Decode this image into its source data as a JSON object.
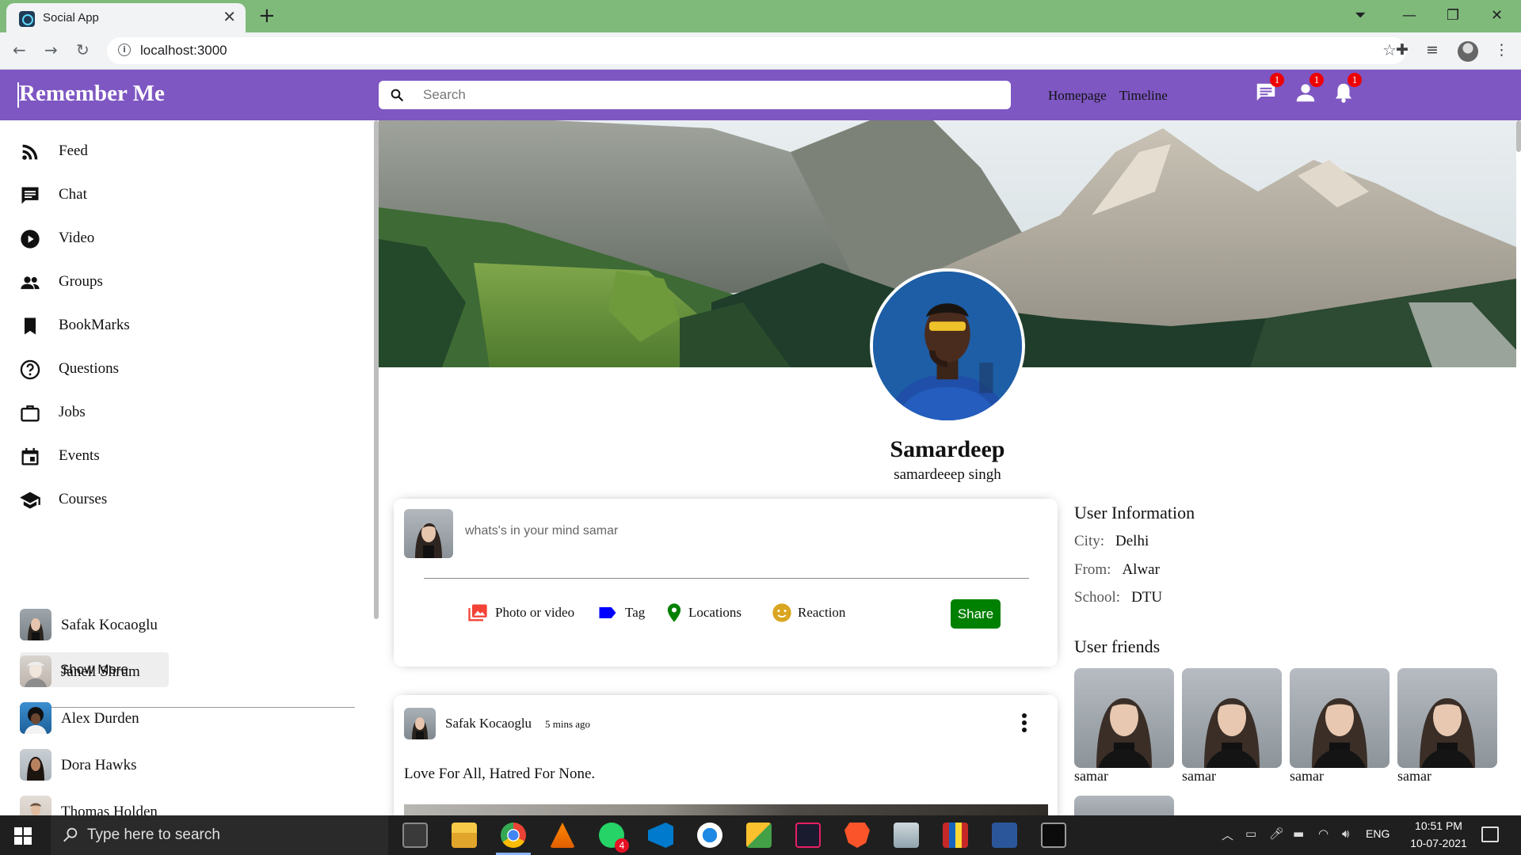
{
  "browser": {
    "tab_title": "Social App",
    "url": "localhost:3000",
    "icons": [
      "back-icon",
      "forward-icon",
      "reload-icon",
      "info-icon",
      "star-icon",
      "extensions-icon",
      "media-icon",
      "profile-icon",
      "menu-icon"
    ]
  },
  "app": {
    "brand": "Remember Me",
    "search_placeholder": "Search",
    "nav_links": [
      "Homepage",
      "Timeline"
    ],
    "badges": {
      "chat": "1",
      "person": "1",
      "notifications": "1"
    },
    "accent_color": "#7e57c2"
  },
  "sidebar": {
    "items": [
      {
        "label": "Feed",
        "icon": "rss-feed-icon"
      },
      {
        "label": "Chat",
        "icon": "chat-icon"
      },
      {
        "label": "Video",
        "icon": "play-circle-icon"
      },
      {
        "label": "Groups",
        "icon": "group-icon"
      },
      {
        "label": "BookMarks",
        "icon": "bookmark-icon"
      },
      {
        "label": "Questions",
        "icon": "help-icon"
      },
      {
        "label": "Jobs",
        "icon": "work-icon"
      },
      {
        "label": "Events",
        "icon": "event-icon"
      },
      {
        "label": "Courses",
        "icon": "school-icon"
      }
    ],
    "show_more": "Show More",
    "friends": [
      "Safak Kocaoglu",
      "Janell Shrum",
      "Alex Durden",
      "Dora Hawks",
      "Thomas Holden"
    ]
  },
  "profile": {
    "name": "Samardeep",
    "description": "samardeeep singh"
  },
  "share": {
    "placeholder": "whats's in your mind samar",
    "options": [
      "Photo or video",
      "Tag",
      "Locations",
      "Reaction"
    ],
    "button": "Share",
    "option_colors": [
      "#f44336",
      "#0000ff",
      "#008000",
      "#daa520"
    ]
  },
  "post": {
    "user": "Safak Kocaoglu",
    "time": "5 mins ago",
    "text": "Love For All, Hatred For None."
  },
  "user_info": {
    "title": "User Information",
    "rows": [
      {
        "key": "City:",
        "value": "Delhi"
      },
      {
        "key": "From:",
        "value": "Alwar"
      },
      {
        "key": "School:",
        "value": "DTU"
      }
    ]
  },
  "user_friends": {
    "title": "User friends",
    "names": [
      "samar",
      "samar",
      "samar",
      "samar"
    ]
  },
  "taskbar": {
    "search_text": "Type here to search",
    "whatsapp_badge": "4",
    "language": "ENG",
    "time": "10:51 PM",
    "date": "10-07-2021"
  }
}
